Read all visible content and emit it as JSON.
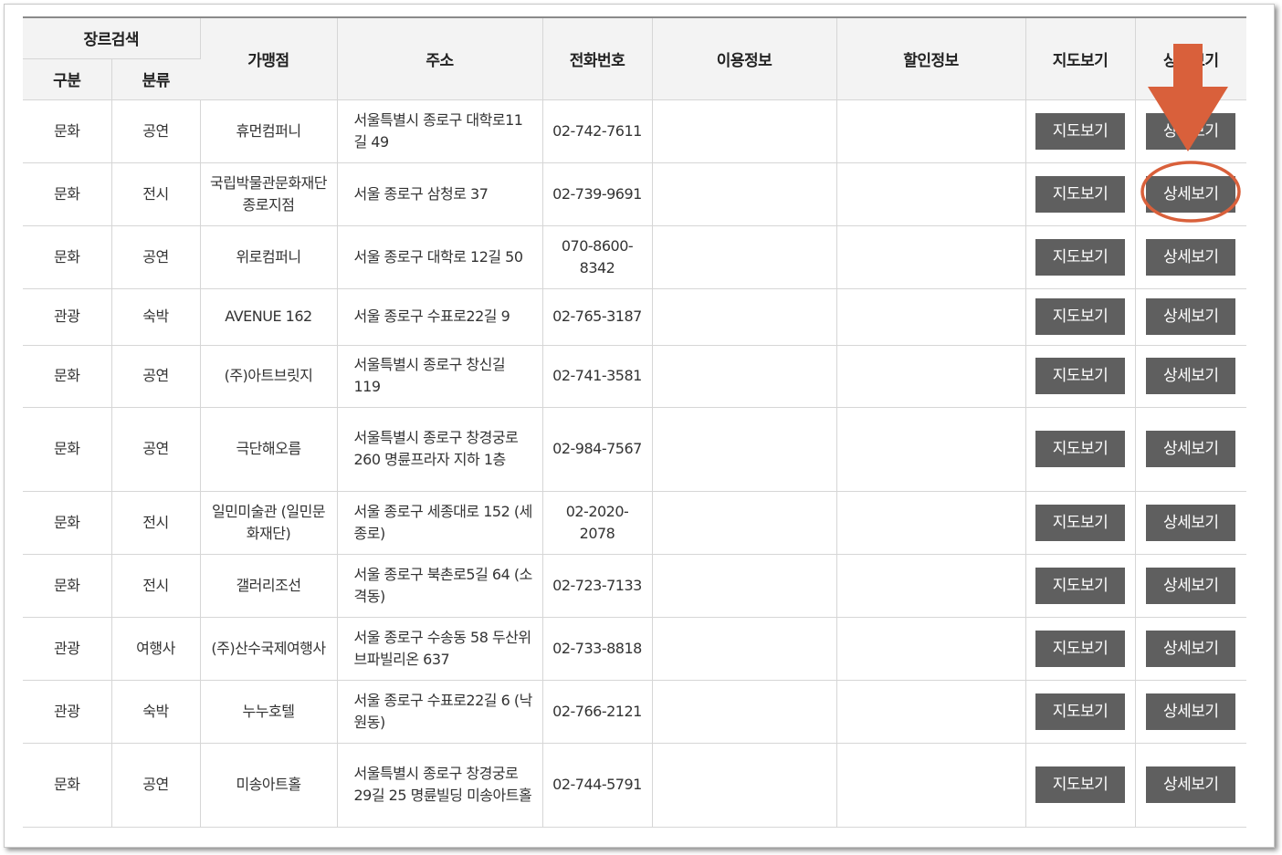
{
  "header": {
    "genre_search": "장르검색",
    "category": "구분",
    "classification": "분류",
    "store": "가맹점",
    "address": "주소",
    "phone": "전화번호",
    "usage_info": "이용정보",
    "discount_info": "할인정보",
    "map_view": "지도보기",
    "detail_view": "상세보기"
  },
  "buttons": {
    "map": "지도보기",
    "detail": "상세보기"
  },
  "rows": [
    {
      "category": "문화",
      "classification": "공연",
      "store": "휴먼컴퍼니",
      "address": "서울특별시 종로구 대학로11길 49",
      "phone": "02-742-7611",
      "usage": "",
      "discount": ""
    },
    {
      "category": "문화",
      "classification": "전시",
      "store": "국립박물관문화재단 종로지점",
      "address": "서울 종로구 삼청로 37",
      "phone": "02-739-9691",
      "usage": "",
      "discount": ""
    },
    {
      "category": "문화",
      "classification": "공연",
      "store": "위로컴퍼니",
      "address": "서울 종로구 대학로 12길 50",
      "phone": "070-8600-8342",
      "usage": "",
      "discount": ""
    },
    {
      "category": "관광",
      "classification": "숙박",
      "store": "AVENUE 162",
      "address": "서울 종로구 수표로22길 9",
      "phone": "02-765-3187",
      "usage": "",
      "discount": ""
    },
    {
      "category": "문화",
      "classification": "공연",
      "store": "(주)아트브릿지",
      "address": "서울특별시 종로구 창신길 119",
      "phone": "02-741-3581",
      "usage": "",
      "discount": ""
    },
    {
      "category": "문화",
      "classification": "공연",
      "store": "극단해오름",
      "address": "서울특별시 종로구 창경궁로 260 명륜프라자 지하 1층",
      "phone": "02-984-7567",
      "usage": "",
      "discount": ""
    },
    {
      "category": "문화",
      "classification": "전시",
      "store": "일민미술관 (일민문화재단)",
      "address": "서울 종로구 세종대로 152 (세종로)",
      "phone": "02-2020-2078",
      "usage": "",
      "discount": ""
    },
    {
      "category": "문화",
      "classification": "전시",
      "store": "갤러리조선",
      "address": "서울 종로구 북촌로5길 64 (소격동)",
      "phone": "02-723-7133",
      "usage": "",
      "discount": ""
    },
    {
      "category": "관광",
      "classification": "여행사",
      "store": "(주)산수국제여행사",
      "address": "서울 종로구 수송동 58 두산위브파빌리온 637",
      "phone": "02-733-8818",
      "usage": "",
      "discount": ""
    },
    {
      "category": "관광",
      "classification": "숙박",
      "store": "누누호텔",
      "address": "서울 종로구 수표로22길 6 (낙원동)",
      "phone": "02-766-2121",
      "usage": "",
      "discount": ""
    },
    {
      "category": "문화",
      "classification": "공연",
      "store": "미송아트홀",
      "address": "서울특별시 종로구 창경궁로29길 25 명륜빌딩 미송아트홀",
      "phone": "02-744-5791",
      "usage": "",
      "discount": ""
    }
  ],
  "annotation": {
    "highlight_row": 1,
    "arrow_color": "#d9603b"
  }
}
